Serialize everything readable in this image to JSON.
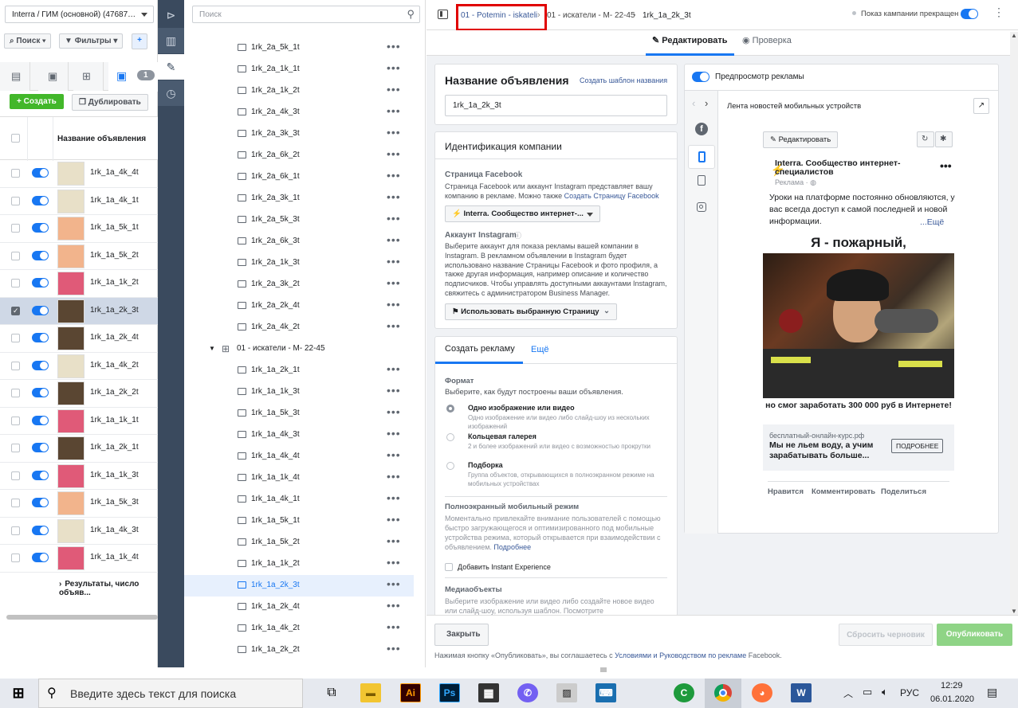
{
  "left": {
    "account": "Interra / ГИМ (основной) (476875...",
    "search_btn": "Поиск",
    "filter_btn": "Фильтры",
    "tab_badge": "1",
    "create_btn": "Создать",
    "duplicate_btn": "Дублировать",
    "column_header": "Название объявления",
    "rows": [
      {
        "name": "1rk_1a_4k_4t",
        "thumb": "#e8e0c8",
        "checked": false
      },
      {
        "name": "1rk_1a_4k_1t",
        "thumb": "#e8e0c8",
        "checked": false
      },
      {
        "name": "1rk_1a_5k_1t",
        "thumb": "#f2b48c",
        "checked": false
      },
      {
        "name": "1rk_1a_5k_2t",
        "thumb": "#f2b48c",
        "checked": false
      },
      {
        "name": "1rk_1a_1k_2t",
        "thumb": "#e05a78",
        "checked": false
      },
      {
        "name": "1rk_1a_2k_3t",
        "thumb": "#5a4632",
        "checked": true
      },
      {
        "name": "1rk_1a_2k_4t",
        "thumb": "#5a4632",
        "checked": false
      },
      {
        "name": "1rk_1a_4k_2t",
        "thumb": "#e8e0c8",
        "checked": false
      },
      {
        "name": "1rk_1a_2k_2t",
        "thumb": "#5a4632",
        "checked": false
      },
      {
        "name": "1rk_1a_1k_1t",
        "thumb": "#e05a78",
        "checked": false
      },
      {
        "name": "1rk_1a_2k_1t",
        "thumb": "#5a4632",
        "checked": false
      },
      {
        "name": "1rk_1a_1k_3t",
        "thumb": "#e05a78",
        "checked": false
      },
      {
        "name": "1rk_1a_5k_3t",
        "thumb": "#f2b48c",
        "checked": false
      },
      {
        "name": "1rk_1a_4k_3t",
        "thumb": "#e8e0c8",
        "checked": false
      },
      {
        "name": "1rk_1a_1k_4t",
        "thumb": "#e05a78",
        "checked": false
      }
    ],
    "results_text": "Результаты, число объяв..."
  },
  "tree": {
    "search_placeholder": "Поиск",
    "items_top": [
      "1rk_2a_5k_1t",
      "1rk_2a_1k_1t",
      "1rk_2a_1k_2t",
      "1rk_2a_4k_3t",
      "1rk_2a_3k_3t",
      "1rk_2a_6k_2t",
      "1rk_2a_6k_1t",
      "1rk_2a_3k_1t",
      "1rk_2a_5k_3t",
      "1rk_2a_6k_3t",
      "1rk_2a_1k_3t",
      "1rk_2a_3k_2t",
      "1rk_2a_2k_4t",
      "1rk_2a_4k_2t"
    ],
    "group_label": "01 - искатели - М- 22-45",
    "items_bottom": [
      "1rk_1a_2k_1t",
      "1rk_1a_1k_3t",
      "1rk_1a_5k_3t",
      "1rk_1a_4k_3t",
      "1rk_1a_4k_4t",
      "1rk_1a_1k_4t",
      "1rk_1a_4k_1t",
      "1rk_1a_5k_1t",
      "1rk_1a_5k_2t",
      "1rk_1a_1k_2t",
      "1rk_1a_2k_3t",
      "1rk_1a_2k_4t",
      "1rk_1a_4k_2t",
      "1rk_1a_2k_2t"
    ],
    "selected": "1rk_1a_2k_3t",
    "dots": "•••"
  },
  "topbar": {
    "crumb1": "01 - Potemin - iskateli",
    "crumb2": "01 - искатели - М- 22-45",
    "crumb3": "1rk_1a_2k_3t",
    "toggle_label": "Показ кампании прекращен",
    "tab_edit": "Редактировать",
    "tab_review": "Проверка"
  },
  "form": {
    "ad_name_title": "Название объявления",
    "create_template": "Создать шаблон названия",
    "ad_name_value": "1rk_1a_2k_3t",
    "identity_title": "Идентификация компании",
    "fb_page_label": "Страница Facebook",
    "fb_page_desc": "Страница Facebook или аккаунт Instagram представляет вашу компанию в рекламе. Можно также",
    "fb_page_link": "Создать Страницу Facebook",
    "fb_page_value": "Interra. Сообщество интернет-...",
    "ig_label": "Аккаунт Instagram",
    "ig_desc": "Выберите аккаунт для показа рекламы вашей компании в Instagram. В рекламном объявлении в Instagram будет использовано название Страницы Facebook и фото профиля, а также другая информация, например описание и количество подписчиков. Чтобы управлять доступными аккаунтами Instagram, свяжитесь с администратором Business Manager.",
    "ig_value": "Использовать выбранную Страницу",
    "create_tab": "Создать рекламу",
    "more_tab": "Ещё",
    "format_label": "Формат",
    "format_desc": "Выберите, как будут построены ваши объявления.",
    "formats": [
      {
        "title": "Одно изображение или видео",
        "desc": "Одно изображение или видео либо слайд-шоу из нескольких изображений",
        "selected": true
      },
      {
        "title": "Кольцевая галерея",
        "desc": "2 и более изображений или видео с возможностью прокрутки",
        "selected": false
      },
      {
        "title": "Подборка",
        "desc": "Группа объектов, открывающихся в полноэкранном режиме на мобильных устройствах",
        "selected": false
      }
    ],
    "fullscreen_label": "Полноэкранный мобильный режим",
    "fullscreen_desc": "Моментально привлекайте внимание пользователей с помощью быстро загружающегося и оптимизированного под мобильные устройства режима, который открывается при взаимодействии с объявлением.",
    "more_link": "Подробнее",
    "instant_exp": "Добавить Instant Experience",
    "media_label": "Медиаобъекты",
    "media_desc": "Выберите изображение или видео либо создайте новое видео или слайд-шоу, используя шаблон. Посмотрите"
  },
  "preview": {
    "toggle_label": "Предпросмотр рекламы",
    "placement": "Лента новостей мобильных устройств",
    "edit_btn": "Редактировать",
    "page_name": "Interra. Сообщество интернет-специалистов",
    "sponsored": "Реклама · ",
    "text": "Уроки на платформе постоянно обновляются, у вас всегда доступ к самой последней и новой информации.",
    "more": "...Ещё",
    "image_top": "Я - пожарный,",
    "image_bottom": "но смог заработать 300 000 руб в Интернете!",
    "domain": "бесплатный-онлайн-курс.рф",
    "headline": "Мы не льем воду, а учим зарабатывать больше...",
    "cta": "ПОДРОБНЕЕ",
    "like": "Нравится",
    "comment": "Комментировать",
    "share": "Поделиться"
  },
  "footer": {
    "close": "Закрыть",
    "reset_draft": "Сбросить черновик",
    "publish": "Опубликовать",
    "terms_prefix": "Нажимая кнопку «Опубликовать», вы соглашаетесь с",
    "terms_link": "Условиями и Руководством по рекламе",
    "terms_suffix": "Facebook."
  },
  "taskbar": {
    "search": "Введите здесь текст для поиска",
    "lang": "РУС",
    "time": "12:29",
    "date": "06.01.2020"
  },
  "colors": {
    "accent": "#1877f2",
    "highlight": "#e00000",
    "publish": "#8fd486"
  }
}
